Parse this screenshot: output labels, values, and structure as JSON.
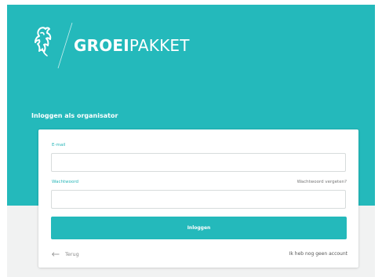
{
  "colors": {
    "brand_teal": "#24b9bb",
    "page_background": "#ffffff",
    "footer_background": "#f1f2f2",
    "card_background": "#ffffff"
  },
  "header": {
    "logo_icon": "lion-icon",
    "logo_text_bold": "GROEI",
    "logo_text_light": "PAKKET"
  },
  "login": {
    "heading": "Inloggen als organisator",
    "email": {
      "label": "E-mail",
      "value": "",
      "placeholder": ""
    },
    "password": {
      "label": "Wachtwoord",
      "value": "",
      "placeholder": "",
      "forgot_link": "Wachtwoord vergeten?"
    },
    "submit_label": "Inloggen",
    "back": {
      "icon": "arrow-left-icon",
      "label": "Terug"
    },
    "no_account_link": "Ik heb nog geen account"
  }
}
